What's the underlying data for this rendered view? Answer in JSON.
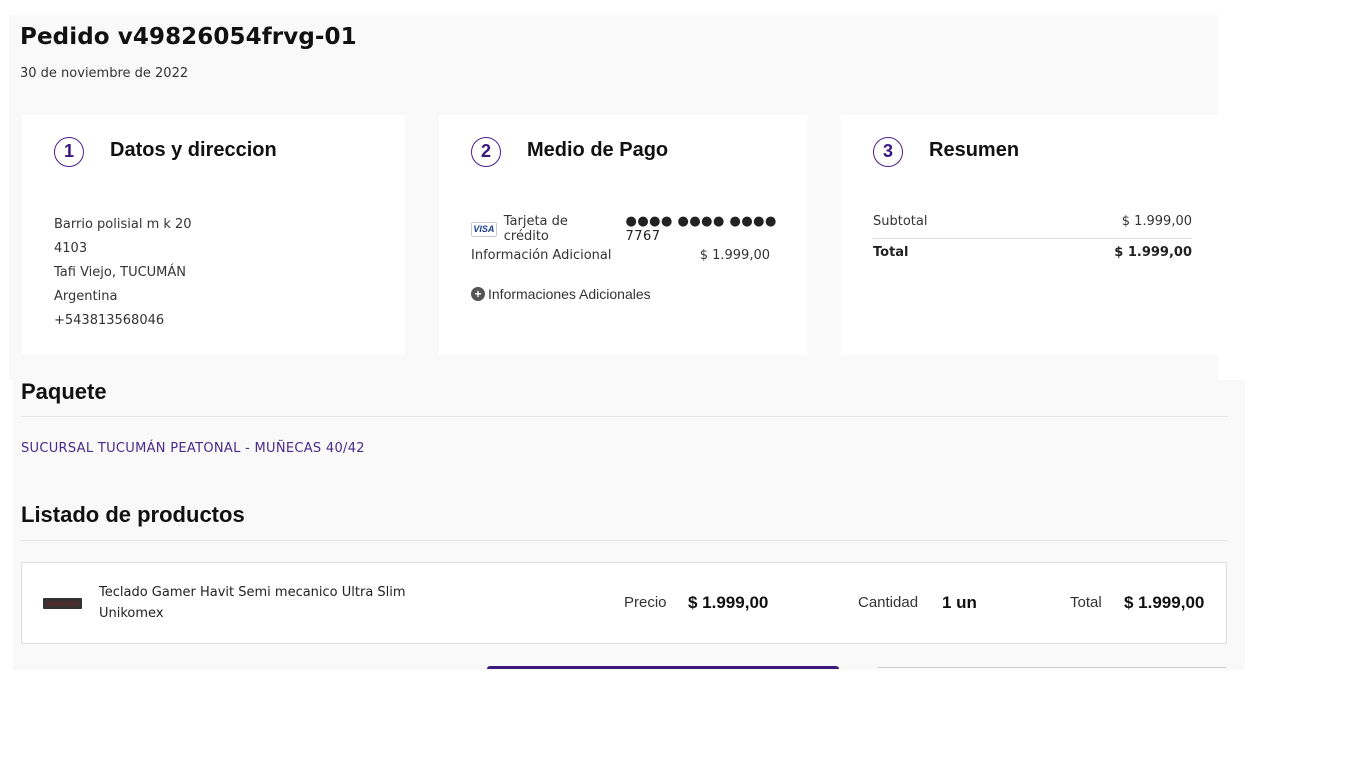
{
  "order": {
    "title": "Pedido v49826054frvg-01",
    "date": "30 de noviembre de 2022"
  },
  "steps": {
    "address": {
      "number": "1",
      "title": "Datos y direccion",
      "lines": [
        "Barrio polisial m k 20",
        "4103",
        "Tafi Viejo, TUCUMÁN",
        "Argentina",
        "+543813568046"
      ]
    },
    "payment": {
      "number": "2",
      "title": "Medio de Pago",
      "card_brand": "VISA",
      "method": "Tarjeta de crédito",
      "card_mask": "●●●● ●●●● ●●●● 7767",
      "info_label": "Información Adicional",
      "info_amount": "$ 1.999,00",
      "more_info": "Informaciones Adicionales"
    },
    "summary": {
      "number": "3",
      "title": "Resumen",
      "subtotal_label": "Subtotal",
      "subtotal_value": "$ 1.999,00",
      "total_label": "Total",
      "total_value": "$ 1.999,00"
    }
  },
  "package": {
    "title": "Paquete",
    "branch": "SUCURSAL TUCUMÁN PEATONAL - MUÑECAS 40/42"
  },
  "products": {
    "title": "Listado de productos",
    "items": [
      {
        "name": "Teclado Gamer Havit Semi mecanico Ultra Slim",
        "seller": "Unikomex",
        "price_label": "Precio",
        "price": "$ 1.999,00",
        "qty_label": "Cantidad",
        "qty": "1 un",
        "total_label": "Total",
        "total": "$ 1.999,00"
      }
    ]
  },
  "colors": {
    "accent": "#3b1a7a",
    "step_circle": "#4b1f8e",
    "branch_text": "#4a2a8a"
  }
}
